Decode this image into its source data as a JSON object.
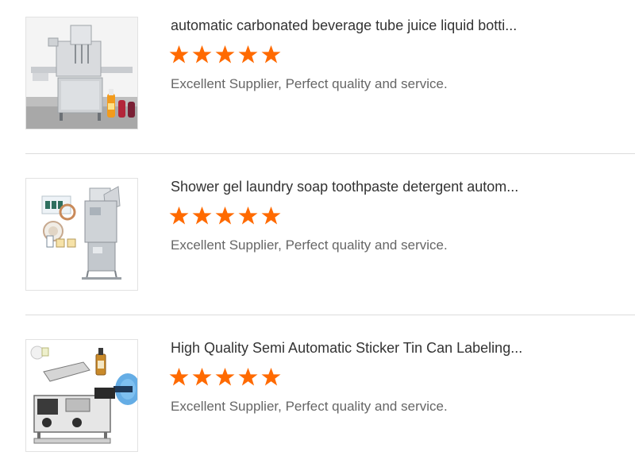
{
  "colors": {
    "star": "#ff6a00",
    "title": "#333333",
    "text": "#666666",
    "divider": "#dcdcdc"
  },
  "reviews": [
    {
      "title": "automatic carbonated beverage tube juice liquid botti...",
      "rating": 5,
      "text": "Excellent Supplier, Perfect quality and service.",
      "thumbnail": "liquid-filling-machine-image"
    },
    {
      "title": "Shower gel laundry soap toothpaste detergent autom...",
      "rating": 5,
      "text": "Excellent Supplier, Perfect quality and service.",
      "thumbnail": "sachet-packing-machine-image"
    },
    {
      "title": "High Quality Semi Automatic Sticker Tin Can Labeling...",
      "rating": 5,
      "text": "Excellent Supplier, Perfect quality and service.",
      "thumbnail": "labeling-machine-image"
    }
  ]
}
